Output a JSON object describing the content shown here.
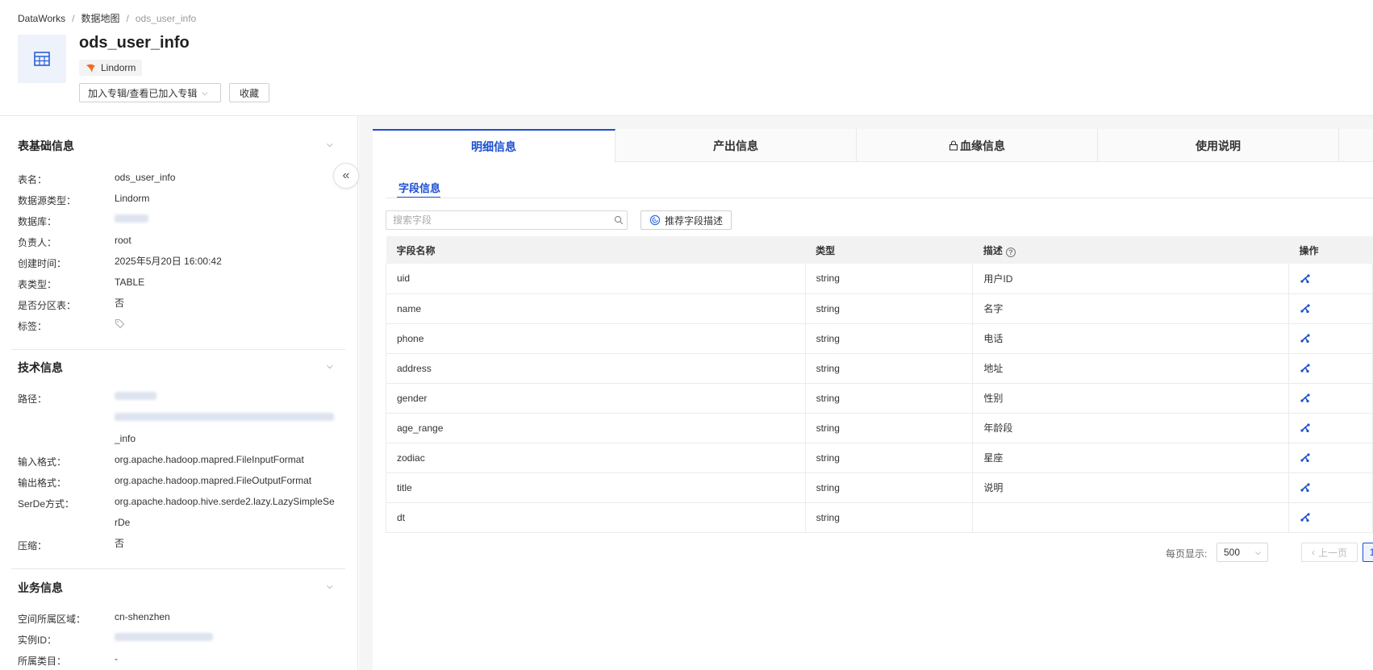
{
  "breadcrumb": {
    "root": "DataWorks",
    "section": "数据地图",
    "current": "ods_user_info"
  },
  "header": {
    "title": "ods_user_info",
    "datasource_tag": "Lindorm",
    "album_button": "加入专辑/查看已加入专辑",
    "favorite_button": "收藏"
  },
  "left": {
    "basic": {
      "title": "表基础信息",
      "rows": [
        {
          "label": "表名：",
          "value": "ods_user_info"
        },
        {
          "label": "数据源类型：",
          "value": "Lindorm"
        },
        {
          "label": "数据库：",
          "value": ""
        },
        {
          "label": "负责人：",
          "value": "root"
        },
        {
          "label": "创建时间：",
          "value": "2025年5月20日 16:00:42"
        },
        {
          "label": "表类型：",
          "value": "TABLE"
        },
        {
          "label": "是否分区表：",
          "value": "否"
        },
        {
          "label": "标签：",
          "value": ""
        }
      ]
    },
    "tech": {
      "title": "技术信息",
      "path_label": "路径：",
      "path_tail": "_info",
      "rows": [
        {
          "label": "输入格式：",
          "value": "org.apache.hadoop.mapred.FileInputFormat"
        },
        {
          "label": "输出格式：",
          "value": "org.apache.hadoop.mapred.FileOutputFormat"
        },
        {
          "label": "SerDe方式：",
          "value": "org.apache.hadoop.hive.serde2.lazy.LazySimpleSerDe"
        },
        {
          "label": "压缩：",
          "value": "否"
        }
      ]
    },
    "biz": {
      "title": "业务信息",
      "rows": [
        {
          "label": "空间所属区域：",
          "value": "cn-shenzhen"
        },
        {
          "label": "实例ID：",
          "value": ""
        },
        {
          "label": "所属类目：",
          "value": "-"
        }
      ]
    }
  },
  "tabs": [
    {
      "label": "明细信息"
    },
    {
      "label": "产出信息"
    },
    {
      "label": "血缘信息"
    },
    {
      "label": "使用说明"
    }
  ],
  "subtab": "字段信息",
  "search": {
    "placeholder": "搜索字段"
  },
  "recommend_button": "推荐字段描述",
  "table": {
    "headers": {
      "name": "字段名称",
      "type": "类型",
      "desc": "描述",
      "op": "操作"
    },
    "rows": [
      {
        "name": "uid",
        "type": "string",
        "desc": "用户ID"
      },
      {
        "name": "name",
        "type": "string",
        "desc": "名字"
      },
      {
        "name": "phone",
        "type": "string",
        "desc": "电话"
      },
      {
        "name": "address",
        "type": "string",
        "desc": "地址"
      },
      {
        "name": "gender",
        "type": "string",
        "desc": "性别"
      },
      {
        "name": "age_range",
        "type": "string",
        "desc": "年龄段"
      },
      {
        "name": "zodiac",
        "type": "string",
        "desc": "星座"
      },
      {
        "name": "title",
        "type": "string",
        "desc": "说明"
      },
      {
        "name": "dt",
        "type": "string",
        "desc": ""
      }
    ]
  },
  "pager": {
    "label": "每页显示:",
    "page_size": "500",
    "prev": "上一页",
    "current_page": "1"
  },
  "colors": {
    "accent": "#1b4fd1",
    "datasource_logo": "#f06a22"
  }
}
